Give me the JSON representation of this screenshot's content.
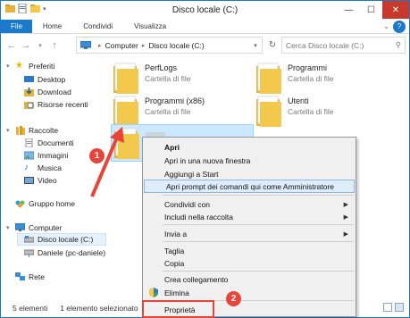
{
  "window": {
    "title": "Disco locale (C:)",
    "minimize": "—",
    "maximize": "☐",
    "close": "✕"
  },
  "ribbon": {
    "tabs": [
      "File",
      "Home",
      "Condividi",
      "Visualizza"
    ],
    "help": "?"
  },
  "address": {
    "crumbs": [
      "Computer",
      "Disco locale (C:)"
    ],
    "search_placeholder": "Cerca Disco locale (C:)"
  },
  "nav_pane": {
    "favorites": "Preferiti",
    "favorites_items": [
      "Desktop",
      "Download",
      "Risorse recenti"
    ],
    "libraries": "Raccolte",
    "libraries_items": [
      "Documenti",
      "Immagini",
      "Musica",
      "Video"
    ],
    "homegroup": "Gruppo home",
    "computer": "Computer",
    "computer_items": [
      "Disco locale (C:)",
      "Daniele (pc-daniele)"
    ],
    "network": "Rete"
  },
  "files": [
    {
      "name": "PerfLogs",
      "type": "Cartella di file"
    },
    {
      "name": "Programmi",
      "type": "Cartella di file"
    },
    {
      "name": "Programmi (x86)",
      "type": "Cartella di file"
    },
    {
      "name": "Utenti",
      "type": "Cartella di file"
    },
    {
      "name": "",
      "type": ""
    }
  ],
  "status_bar": {
    "count": "5 elementi",
    "selected": "1 elemento selezionato"
  },
  "context_menu": {
    "open": "Apri",
    "open_new_window": "Apri in una nuova finestra",
    "pin_start": "Aggiungi a Start",
    "open_cmd_admin": "Apri prompt dei comandi qui come Amministratore",
    "share_with": "Condividi con",
    "include_library": "Includi nella raccolta",
    "send_to": "Invia a",
    "cut": "Taglia",
    "copy": "Copia",
    "create_shortcut": "Crea collegamento",
    "delete": "Elimina",
    "properties": "Proprietà"
  },
  "annotations": {
    "step1": "1",
    "step2": "2"
  },
  "colors": {
    "accent": "#1979ca",
    "annotation_red": "#e8453a",
    "folder_yellow": "#f2c94c",
    "selection": "#cce8ff"
  }
}
